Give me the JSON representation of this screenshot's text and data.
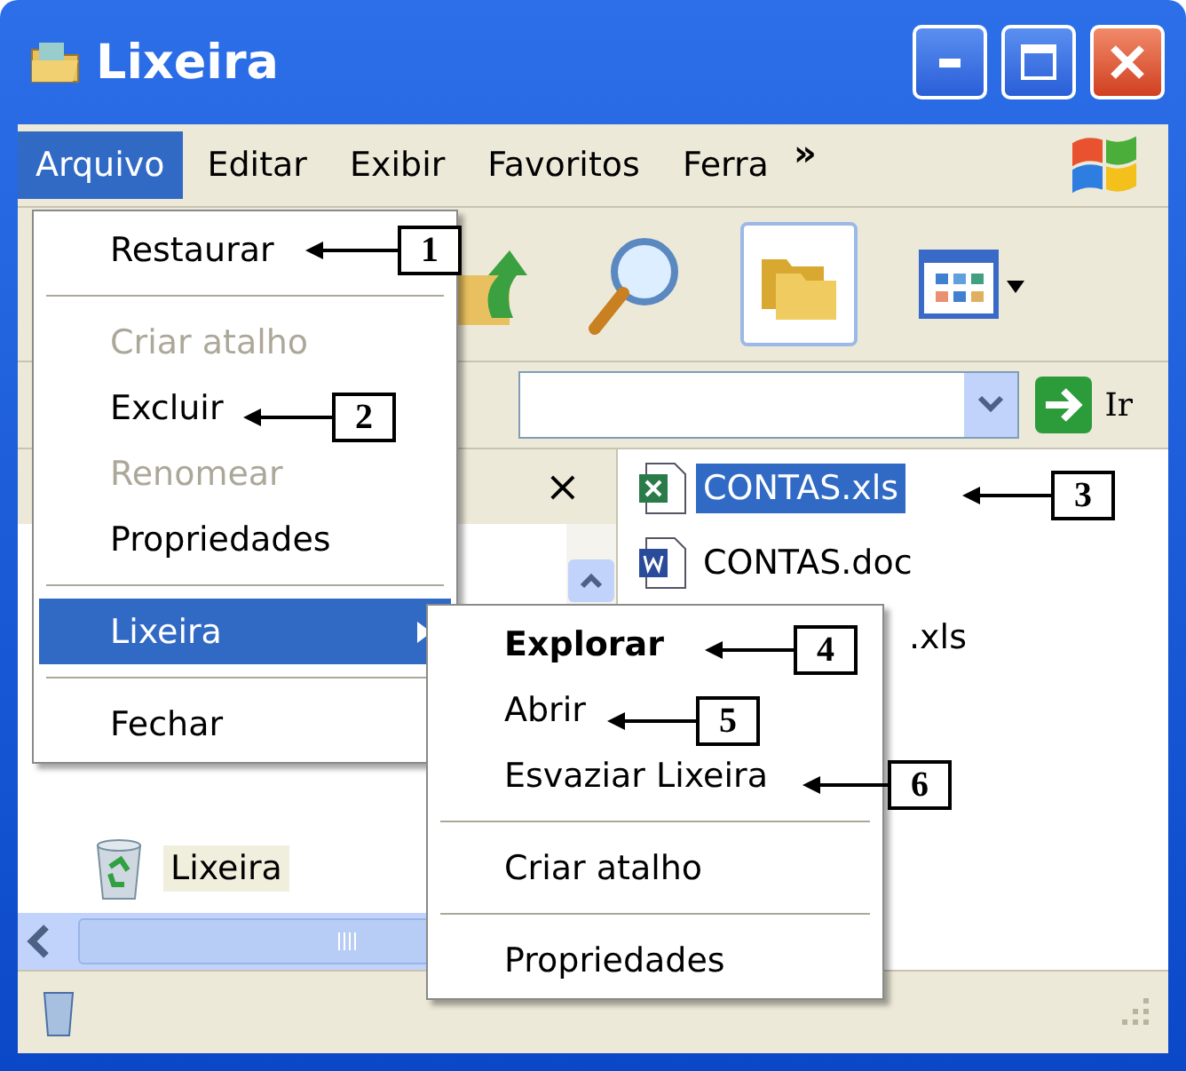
{
  "window": {
    "title": "Lixeira"
  },
  "menu_bar": {
    "items": [
      {
        "label": "Arquivo",
        "selected": true
      },
      {
        "label": "Editar",
        "selected": false
      },
      {
        "label": "Exibir",
        "selected": false
      },
      {
        "label": "Favoritos",
        "selected": false
      },
      {
        "label": "Ferra",
        "selected": false
      }
    ],
    "overflow": "»"
  },
  "address_bar": {
    "go_label": "Ir"
  },
  "folder_pane": {
    "close": "×",
    "items": [
      {
        "label": "Lixeira",
        "selected": true
      }
    ]
  },
  "files": [
    {
      "name": "CONTAS.xls",
      "kind": "spreadsheet",
      "selected": true
    },
    {
      "name": "CONTAS.doc",
      "kind": "document",
      "selected": false
    },
    {
      "name": ".xls",
      "kind": "partial",
      "selected": false
    }
  ],
  "file_menu": [
    {
      "kind": "item",
      "label": "Restaurar",
      "disabled": false,
      "selected": false
    },
    {
      "kind": "separator"
    },
    {
      "kind": "item",
      "label": "Criar atalho",
      "disabled": true,
      "selected": false
    },
    {
      "kind": "item",
      "label": "Excluir",
      "disabled": false,
      "selected": false
    },
    {
      "kind": "item",
      "label": "Renomear",
      "disabled": true,
      "selected": false
    },
    {
      "kind": "item",
      "label": "Propriedades",
      "disabled": false,
      "selected": false
    },
    {
      "kind": "separator"
    },
    {
      "kind": "submenu",
      "label": "Lixeira",
      "disabled": false,
      "selected": true
    },
    {
      "kind": "separator"
    },
    {
      "kind": "item",
      "label": "Fechar",
      "disabled": false,
      "selected": false
    }
  ],
  "submenu": [
    {
      "kind": "item",
      "label": "Explorar",
      "default": true
    },
    {
      "kind": "item",
      "label": "Abrir",
      "default": false
    },
    {
      "kind": "item",
      "label": "Esvaziar Lixeira",
      "default": false
    },
    {
      "kind": "separator"
    },
    {
      "kind": "item",
      "label": "Criar atalho",
      "default": false
    },
    {
      "kind": "separator"
    },
    {
      "kind": "item",
      "label": "Propriedades",
      "default": false
    }
  ],
  "callouts": [
    "1",
    "2",
    "3",
    "4",
    "5",
    "6"
  ]
}
